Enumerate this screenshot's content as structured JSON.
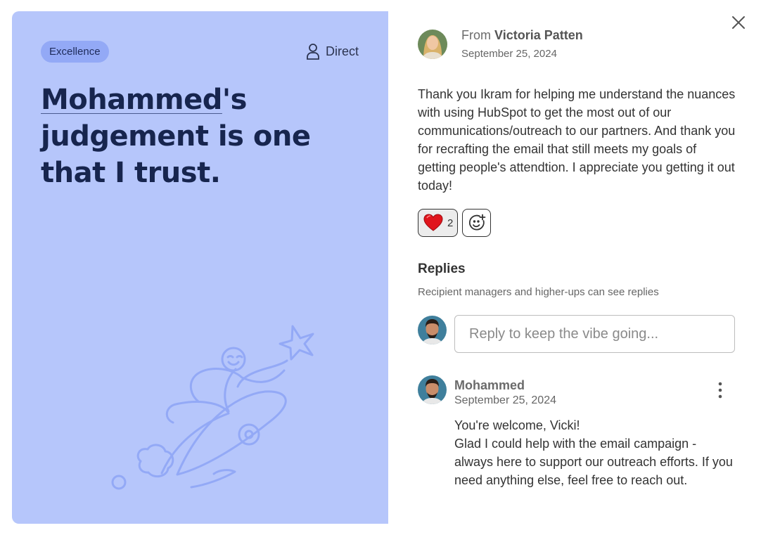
{
  "card": {
    "badge": "Excellence",
    "audience": "Direct",
    "headline_name": "Mohammed",
    "headline_rest": "'s judgement is one that I trust.",
    "illustration_icon": "rocket-rider-illustration",
    "background_color": "#b6c6fb"
  },
  "sender": {
    "from_prefix": "From",
    "name": "Victoria Patten",
    "date": "September 25, 2024"
  },
  "message": "Thank you Ikram for helping me understand the nuances with using HubSpot to get the most out of our communications/outreach to our partners. And thank you for recrafting the email that still meets my goals of getting people's attendtion. I appreciate you getting it out today!",
  "reactions": {
    "heart_icon": "heart-icon",
    "heart_count": "2",
    "add_icon": "add-reaction-icon"
  },
  "replies": {
    "title": "Replies",
    "subtitle": "Recipient managers and higher-ups can see replies",
    "input_placeholder": "Reply to keep the vibe going...",
    "items": [
      {
        "author": "Mohammed",
        "date": "September 25, 2024",
        "line1": "You're welcome, Vicki!",
        "line2": "Glad I could help with the email campaign - always here to support our outreach efforts. If you need anything else, feel free to reach out."
      }
    ]
  }
}
